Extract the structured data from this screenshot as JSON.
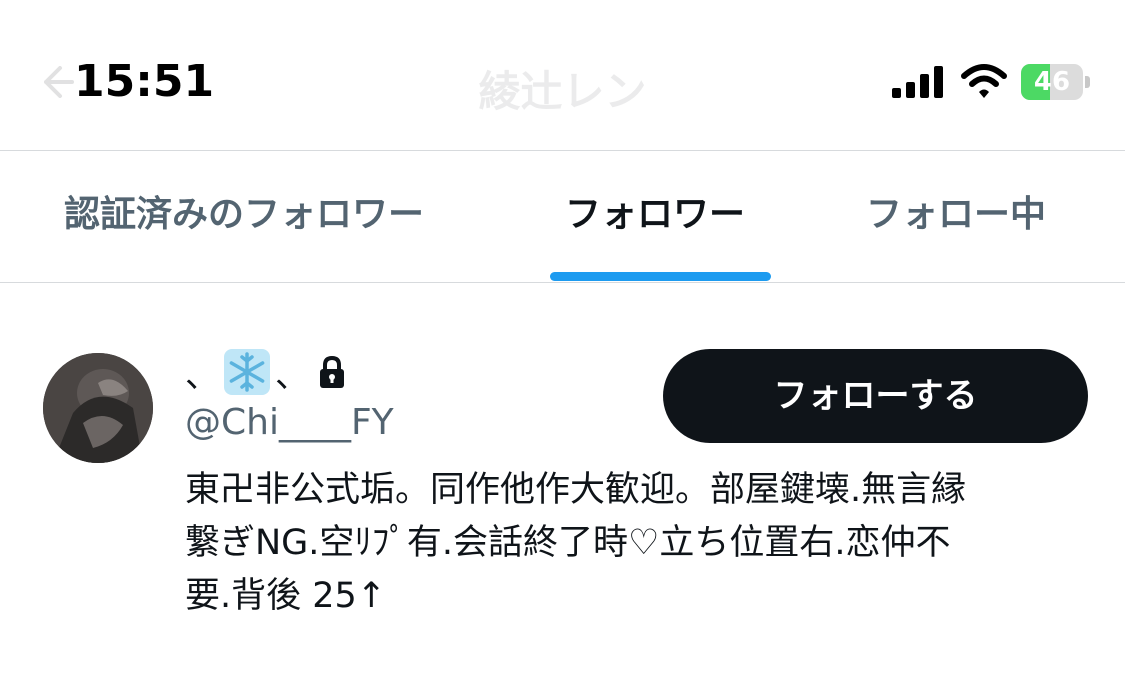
{
  "status_bar": {
    "time": "15:51",
    "battery_percent": "46",
    "battery_level": 0.46,
    "battery_color": "#4cd964"
  },
  "header": {
    "title": "綾辻レン",
    "back_icon": "arrow-left-icon"
  },
  "tabs": [
    {
      "label": "認証済みのフォロワー",
      "active": false
    },
    {
      "label": "フォロワー",
      "active": true
    },
    {
      "label": "フォロー中",
      "active": false
    }
  ],
  "accent_color": "#1d9bf0",
  "user": {
    "name_prefix": "、",
    "name_emoji": "snowflake-icon",
    "name_suffix": "、",
    "protected_icon": "lock-icon",
    "handle": "@Chi____FY",
    "follow_label": "フォローする",
    "bio_lines": [
      "東卍非公式垢。同作他作大歓迎。部屋鍵壊.無言縁",
      "繋ぎNG.空ﾘﾌﾟ有.会話終了時♡立ち位置右.恋仲不",
      "要.背後 25↑"
    ]
  }
}
